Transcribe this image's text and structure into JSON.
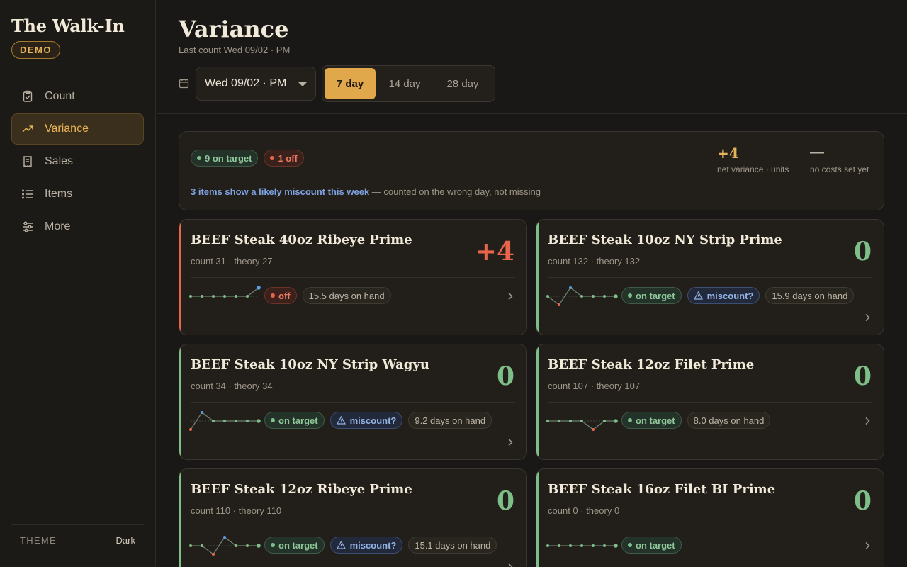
{
  "sidebar": {
    "brand": "The Walk-In",
    "badge": "DEMO",
    "nav": [
      {
        "label": "Count",
        "icon": "clipboard-check-icon"
      },
      {
        "label": "Variance",
        "icon": "trend-up-icon",
        "active": true
      },
      {
        "label": "Sales",
        "icon": "receipt-icon"
      },
      {
        "label": "Items",
        "icon": "list-icon"
      },
      {
        "label": "More",
        "icon": "sliders-icon"
      }
    ],
    "theme_label": "THEME",
    "theme_value": "Dark"
  },
  "header": {
    "title": "Variance",
    "subtitle": "Last count Wed 09/02 · PM",
    "date_value": "Wed 09/02 · PM",
    "ranges": [
      "7 day",
      "14 day",
      "28 day"
    ],
    "active_range": "7 day"
  },
  "summary": {
    "on_target_pill": "9 on target",
    "off_pill": "1 off",
    "note_strong": "3 items show a likely miscount this week",
    "note_rest": " — counted on the wrong day, not missing",
    "net_variance_value": "+4",
    "net_variance_label": "net variance · units",
    "costs_value": "—",
    "costs_label": "no costs set yet"
  },
  "colors": {
    "accent": "#e0a84a",
    "off": "#e8654b",
    "on_target": "#7dbe89",
    "miscount": "#93b3e6"
  },
  "items": [
    {
      "name": "BEEF Steak 40oz Ribeye Prime",
      "counts": "count 31 · theory 27",
      "variance": "+4",
      "status": "off",
      "status_label": "off",
      "miscount": false,
      "miscount_label": "",
      "days": "15.5 days on hand",
      "spark": [
        0,
        0,
        0,
        0,
        0,
        0,
        4
      ]
    },
    {
      "name": "BEEF Steak 10oz NY Strip Prime",
      "counts": "count 132 · theory 132",
      "variance": "0",
      "status": "on",
      "status_label": "on target",
      "miscount": true,
      "miscount_label": "miscount?",
      "days": "15.9 days on hand",
      "spark": [
        0,
        -4,
        4,
        0,
        0,
        0,
        0
      ]
    },
    {
      "name": "BEEF Steak 10oz NY Strip Wagyu",
      "counts": "count 34 · theory 34",
      "variance": "0",
      "status": "on",
      "status_label": "on target",
      "miscount": true,
      "miscount_label": "miscount?",
      "days": "9.2 days on hand",
      "spark": [
        -4,
        4,
        0,
        0,
        0,
        0,
        0
      ]
    },
    {
      "name": "BEEF Steak 12oz Filet Prime",
      "counts": "count 107 · theory 107",
      "variance": "0",
      "status": "on",
      "status_label": "on target",
      "miscount": false,
      "miscount_label": "",
      "days": "8.0 days on hand",
      "spark": [
        0,
        0,
        0,
        0,
        -4,
        0,
        0
      ]
    },
    {
      "name": "BEEF Steak 12oz Ribeye Prime",
      "counts": "count 110 · theory 110",
      "variance": "0",
      "status": "on",
      "status_label": "on target",
      "miscount": true,
      "miscount_label": "miscount?",
      "days": "15.1 days on hand",
      "spark": [
        0,
        0,
        -4,
        4,
        0,
        0,
        0
      ]
    },
    {
      "name": "BEEF Steak 16oz Filet BI Prime",
      "counts": "count 0 · theory 0",
      "variance": "0",
      "status": "on",
      "status_label": "on target",
      "miscount": false,
      "miscount_label": "",
      "days": "",
      "spark": [
        0,
        0,
        0,
        0,
        0,
        0,
        0
      ]
    }
  ]
}
